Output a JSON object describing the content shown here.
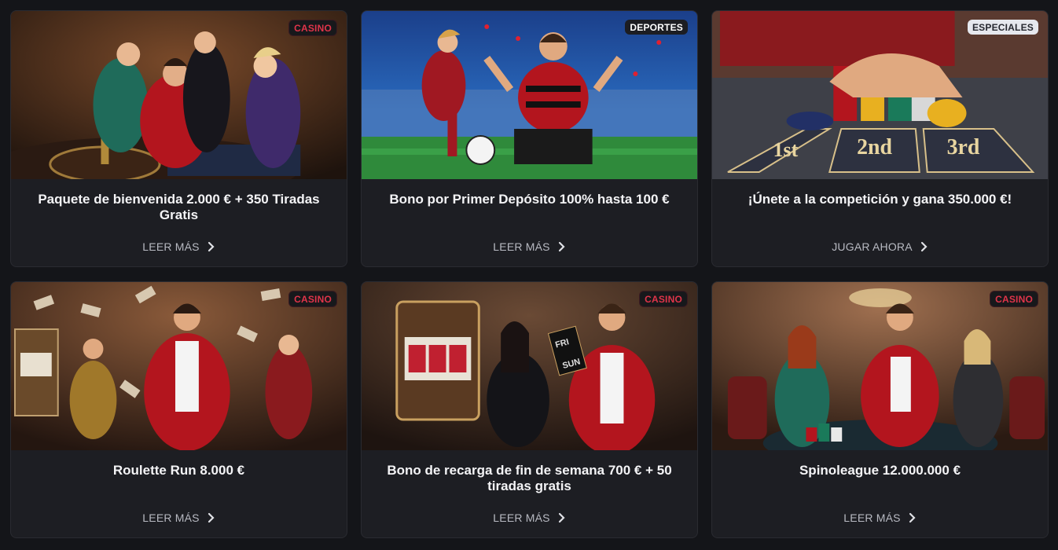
{
  "promotions": [
    {
      "badge": "CASINO",
      "badge_style": "casino",
      "title": "Paquete de bienvenida 2.000 € + 350 Tiradas Gratis",
      "cta": "LEER MÁS",
      "theme": "casino-roulette"
    },
    {
      "badge": "DEPORTES",
      "badge_style": "sports",
      "title": "Bono por Primer Depósito 100% hasta 100 €",
      "cta": "LEER MÁS",
      "theme": "football-stadium"
    },
    {
      "badge": "ESPECIALES",
      "badge_style": "special",
      "title": "¡Únete a la competición y gana 350.000 €!",
      "cta": "JUGAR AHORA",
      "theme": "chips-table",
      "table_labels": [
        "1st",
        "2nd",
        "3rd"
      ]
    },
    {
      "badge": "CASINO",
      "badge_style": "casino",
      "title": "Roulette Run 8.000 €",
      "cta": "LEER MÁS",
      "theme": "money-rain"
    },
    {
      "badge": "CASINO",
      "badge_style": "casino",
      "title": "Bono de recarga de fin de semana 700 € + 50 tiradas gratis",
      "cta": "LEER MÁS",
      "theme": "slot-machine",
      "sign_lines": [
        "FRI",
        "SUN"
      ]
    },
    {
      "badge": "CASINO",
      "badge_style": "casino",
      "title": "Spinoleague 12.000.000 €",
      "cta": "LEER MÁS",
      "theme": "card-table"
    }
  ],
  "colors": {
    "background": "#141519",
    "card": "#1d1e23",
    "casino_badge": "#e0344a",
    "accent_red": "#b3151e"
  },
  "icons": {
    "cta_arrow": "chevron-right-icon"
  }
}
